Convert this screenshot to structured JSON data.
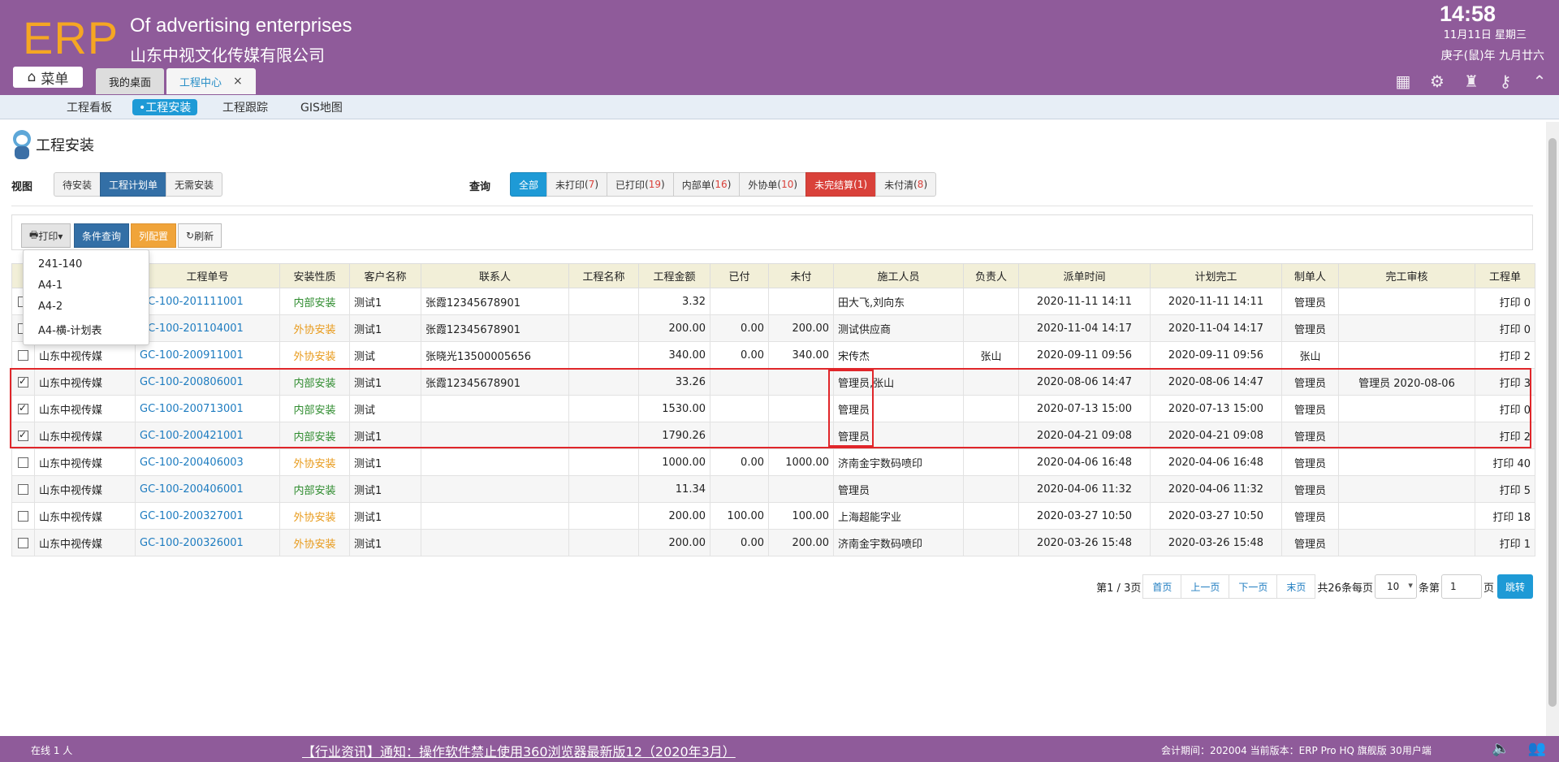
{
  "header": {
    "logo": "ERP",
    "company_en": "Of advertising enterprises",
    "company_cn": "山东中视文化传媒有限公司",
    "time": "14:58",
    "date": "11月11日 星期三",
    "lunar": "庚子(鼠)年 九月廿六",
    "menu_label": "菜单",
    "tabs": [
      {
        "label": "我的桌面"
      },
      {
        "label": "工程中心",
        "close": "×"
      }
    ]
  },
  "subnav": {
    "items": [
      "工程看板",
      "•工程安装",
      "工程跟踪",
      "GIS地图"
    ]
  },
  "page": {
    "title": "工程安装",
    "view_label": "视图",
    "views": [
      "待安装",
      "工程计划单",
      "无需安装"
    ],
    "query_label": "查询",
    "filters": [
      {
        "label": "全部",
        "count": ""
      },
      {
        "label": "未打印",
        "count": "7"
      },
      {
        "label": "已打印",
        "count": "19"
      },
      {
        "label": "内部单",
        "count": "16"
      },
      {
        "label": "外协单",
        "count": "10"
      },
      {
        "label": "未完结算",
        "count": "1"
      },
      {
        "label": "未付清",
        "count": "8"
      }
    ]
  },
  "toolbar": {
    "print": "打印▾",
    "condition_query": "条件查询",
    "column_config": "列配置",
    "refresh": "刷新"
  },
  "print_menu": [
    "241-140",
    "A4-1",
    "A4-2",
    "A4-横-计划表"
  ],
  "table": {
    "headers": [
      "",
      "",
      "工程单号",
      "安装性质",
      "客户名称",
      "联系人",
      "工程名称",
      "工程金额",
      "已付",
      "未付",
      "施工人员",
      "负责人",
      "派单时间",
      "计划完工",
      "制单人",
      "完工审核",
      "工程单"
    ],
    "rows": [
      {
        "checked": false,
        "company": "",
        "no": "GC-100-201111001",
        "type": "内部安装",
        "client": "测试1",
        "contact": "张霞12345678901",
        "name": "",
        "amount": "3.32",
        "paid": "",
        "unpaid": "",
        "workers": "田大飞,刘向东",
        "owner": "",
        "dispatch": "2020-11-11 14:11",
        "plan": "2020-11-11 14:11",
        "maker": "管理员",
        "audit": "",
        "print": "打印 0"
      },
      {
        "checked": false,
        "company": "",
        "no": "GC-100-201104001",
        "type": "外协安装",
        "client": "测试1",
        "contact": "张霞12345678901",
        "name": "",
        "amount": "200.00",
        "paid": "0.00",
        "unpaid": "200.00",
        "workers": "测试供应商",
        "owner": "",
        "dispatch": "2020-11-04 14:17",
        "plan": "2020-11-04 14:17",
        "maker": "管理员",
        "audit": "",
        "print": "打印 0"
      },
      {
        "checked": false,
        "company": "山东中视传媒",
        "no": "GC-100-200911001",
        "type": "外协安装",
        "client": "测试",
        "contact": "张晓光13500005656",
        "name": "",
        "amount": "340.00",
        "paid": "0.00",
        "unpaid": "340.00",
        "workers": "宋传杰",
        "owner": "张山",
        "dispatch": "2020-09-11 09:56",
        "plan": "2020-09-11 09:56",
        "maker": "张山",
        "audit": "",
        "print": "打印 2"
      },
      {
        "checked": true,
        "company": "山东中视传媒",
        "no": "GC-100-200806001",
        "type": "内部安装",
        "client": "测试1",
        "contact": "张霞12345678901",
        "name": "",
        "amount": "33.26",
        "paid": "",
        "unpaid": "",
        "workers": "管理员,张山",
        "owner": "",
        "dispatch": "2020-08-06 14:47",
        "plan": "2020-08-06 14:47",
        "maker": "管理员",
        "audit": "管理员 2020-08-06",
        "print": "打印 3"
      },
      {
        "checked": true,
        "company": "山东中视传媒",
        "no": "GC-100-200713001",
        "type": "内部安装",
        "client": "测试",
        "contact": "",
        "name": "",
        "amount": "1530.00",
        "paid": "",
        "unpaid": "",
        "workers": "管理员",
        "owner": "",
        "dispatch": "2020-07-13 15:00",
        "plan": "2020-07-13 15:00",
        "maker": "管理员",
        "audit": "",
        "print": "打印 0"
      },
      {
        "checked": true,
        "company": "山东中视传媒",
        "no": "GC-100-200421001",
        "type": "内部安装",
        "client": "测试1",
        "contact": "",
        "name": "",
        "amount": "1790.26",
        "paid": "",
        "unpaid": "",
        "workers": "管理员",
        "owner": "",
        "dispatch": "2020-04-21 09:08",
        "plan": "2020-04-21 09:08",
        "maker": "管理员",
        "audit": "",
        "print": "打印 2"
      },
      {
        "checked": false,
        "company": "山东中视传媒",
        "no": "GC-100-200406003",
        "type": "外协安装",
        "client": "测试1",
        "contact": "",
        "name": "",
        "amount": "1000.00",
        "paid": "0.00",
        "unpaid": "1000.00",
        "workers": "济南金宇数码喷印",
        "owner": "",
        "dispatch": "2020-04-06 16:48",
        "plan": "2020-04-06 16:48",
        "maker": "管理员",
        "audit": "",
        "print": "打印 40"
      },
      {
        "checked": false,
        "company": "山东中视传媒",
        "no": "GC-100-200406001",
        "type": "内部安装",
        "client": "测试1",
        "contact": "",
        "name": "",
        "amount": "11.34",
        "paid": "",
        "unpaid": "",
        "workers": "管理员",
        "owner": "",
        "dispatch": "2020-04-06 11:32",
        "plan": "2020-04-06 11:32",
        "maker": "管理员",
        "audit": "",
        "print": "打印 5"
      },
      {
        "checked": false,
        "company": "山东中视传媒",
        "no": "GC-100-200327001",
        "type": "外协安装",
        "client": "测试1",
        "contact": "",
        "name": "",
        "amount": "200.00",
        "paid": "100.00",
        "unpaid": "100.00",
        "workers": "上海超能字业",
        "owner": "",
        "dispatch": "2020-03-27 10:50",
        "plan": "2020-03-27 10:50",
        "maker": "管理员",
        "audit": "",
        "print": "打印 18"
      },
      {
        "checked": false,
        "company": "山东中视传媒",
        "no": "GC-100-200326001",
        "type": "外协安装",
        "client": "测试1",
        "contact": "",
        "name": "",
        "amount": "200.00",
        "paid": "0.00",
        "unpaid": "200.00",
        "workers": "济南金宇数码喷印",
        "owner": "",
        "dispatch": "2020-03-26 15:48",
        "plan": "2020-03-26 15:48",
        "maker": "管理员",
        "audit": "",
        "print": "打印 1"
      }
    ]
  },
  "pager": {
    "page_info": "第1 / 3页",
    "first": "首页",
    "prev": "上一页",
    "next": "下一页",
    "last": "末页",
    "total": "共26条每页",
    "page_size": "10",
    "per_unit": "条第",
    "page_input": "1",
    "page_unit": "页",
    "go": "跳转"
  },
  "footer": {
    "online": "在线  1  人",
    "news": "【行业资讯】通知：操作软件禁止使用360浏览器最新版12（2020年3月）",
    "account": "会计期间：202004 当前版本：ERP Pro HQ 旗舰版 30用户端"
  },
  "colors": {
    "header_bg": "#8f5b9a",
    "accent_blue": "#1e9ad6",
    "highlight_red": "#e0262a",
    "logo_orange": "#f5a623"
  }
}
